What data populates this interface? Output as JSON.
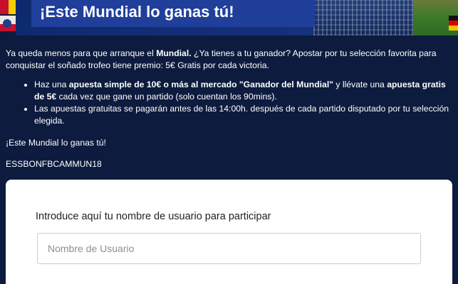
{
  "hero": {
    "title": "¡Este Mundial lo ganas tú!"
  },
  "intro": {
    "text_1": "Ya queda menos para que arranque el ",
    "bold_1": "Mundial.",
    "text_2": " ¿Ya tienes a tu ganador? Apostar por tu selección favorita para conquistar el soñado trofeo tiene premio: 5€ Gratis por cada victoria."
  },
  "bullets": {
    "item_1": {
      "text_1": "Haz una ",
      "bold_1": "apuesta simple de 10€ o más al mercado \"Ganador del Mundial\"",
      "text_2": " y llévate una ",
      "bold_2": "apuesta gratis de 5€",
      "text_3": " cada vez que gane un partido (solo cuentan los 90mins)."
    },
    "item_2": {
      "text": "Las apuestas gratuitas se pagarán antes de las 14:00h. después de cada partido disputado por tu selección elegida."
    }
  },
  "closing": "¡Este Mundial lo ganas tú!",
  "promo_code": "ESSBONFBCAMMUN18",
  "form": {
    "label": "Introduce aquí tu nombre de usuario para participar",
    "username": {
      "value": "",
      "placeholder": "Nombre de Usuario"
    }
  },
  "colors": {
    "page_background": "#0d1b3e",
    "title_box": "#1f3f9a",
    "text": "#ffffff"
  }
}
